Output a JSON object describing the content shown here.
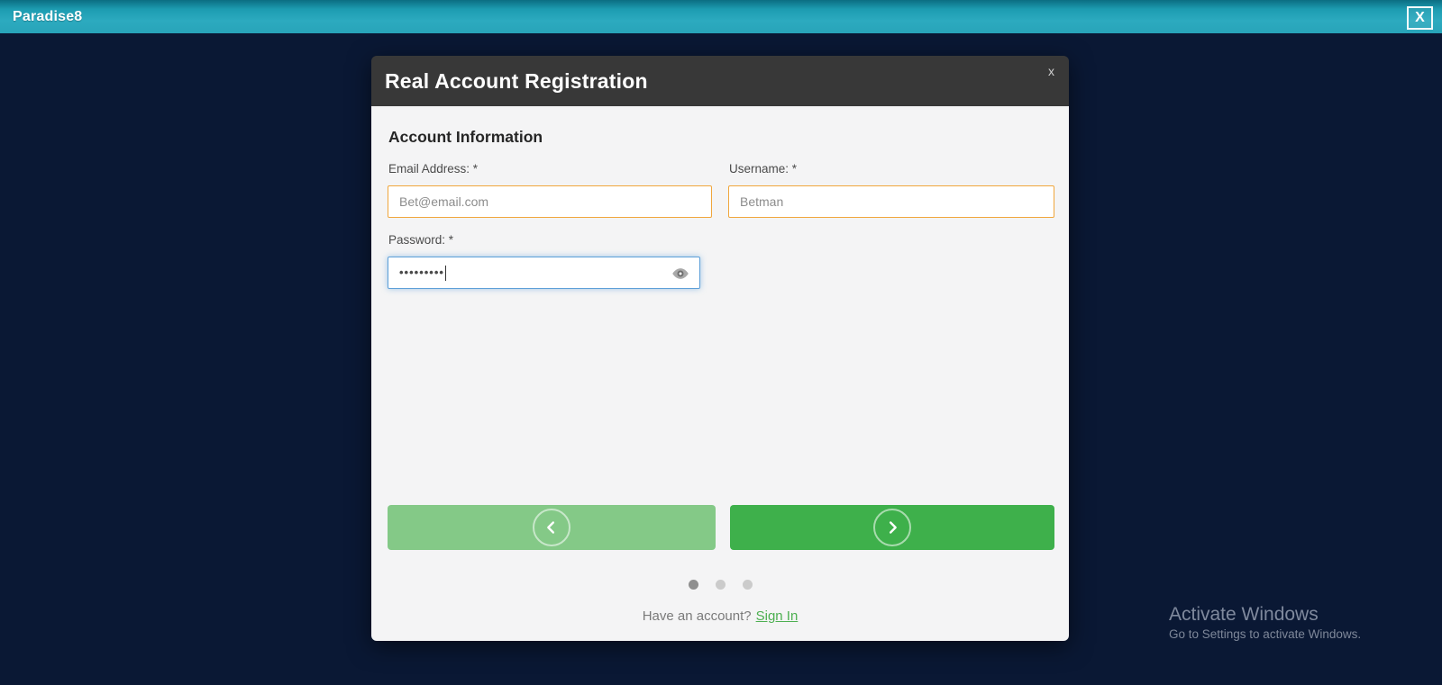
{
  "titlebar": {
    "app_name": "Paradise8",
    "close_label": "X"
  },
  "modal": {
    "title": "Real Account Registration",
    "close_label": "x",
    "section_heading": "Account Information",
    "email": {
      "label": "Email Address: *",
      "value": "Bet@email.com"
    },
    "username": {
      "label": "Username: *",
      "value": "Betman"
    },
    "password": {
      "label": "Password: *",
      "masked_value": "•••••••••"
    },
    "pagination": {
      "dot_count": 3,
      "active_index": 0
    },
    "signin": {
      "text": "Have an account?",
      "link_label": "Sign In"
    }
  },
  "watermark": {
    "line1": "Activate Windows",
    "line2": "Go to Settings to activate Windows."
  },
  "colors": {
    "titlebar_teal": "#2aa9be",
    "page_bg": "#0a1834",
    "modal_header_bg": "#383838",
    "modal_body_bg": "#f4f4f5",
    "input_border_warning": "#f0a63c",
    "input_border_focus": "#5d9fd8",
    "button_green": "#3eb04b",
    "button_green_disabled": "#84c987",
    "link_green": "#4caf50",
    "active_dot": "#8f8f8f",
    "inactive_dot": "#cbcbcb"
  }
}
